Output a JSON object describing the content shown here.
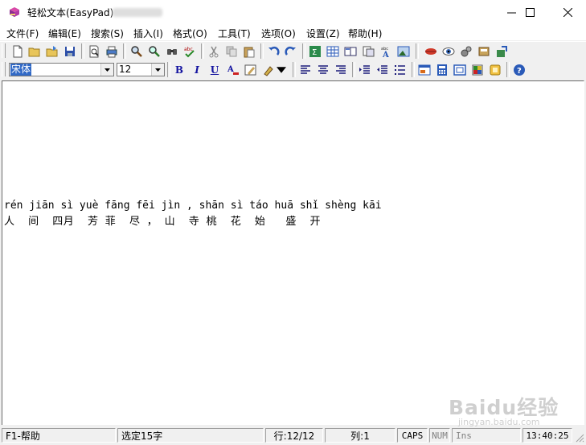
{
  "window": {
    "title": "轻松文本(EasyPad)"
  },
  "menu": [
    {
      "label": "文件(F)"
    },
    {
      "label": "编辑(E)"
    },
    {
      "label": "搜索(S)"
    },
    {
      "label": "插入(I)"
    },
    {
      "label": "格式(O)"
    },
    {
      "label": "工具(T)"
    },
    {
      "label": "选项(O)"
    },
    {
      "label": "设置(Z)"
    },
    {
      "label": "帮助(H)"
    }
  ],
  "toolbar2": {
    "font_name": "宋体",
    "font_size": "12",
    "bold_label": "B",
    "italic_label": "I",
    "underline_label": "U"
  },
  "editor": {
    "pinyin_line": "rén jiān sì yuè fāng fēi jìn , shān sì táo huā shǐ shèng kāi",
    "hanzi_line": "人  间  四月  芳 菲  尽 ， 山  寺 桃  花  始   盛  开"
  },
  "statusbar": {
    "help": "F1-帮助",
    "selection": "选定15字",
    "line": "行:12/12",
    "column": "列:1",
    "caps": "CAPS",
    "num": "NUM",
    "ins": "Ins",
    "time": "13:40:25"
  },
  "watermark": {
    "main": "Baidu经验",
    "sub": "jingyan.baidu.com"
  },
  "icons": [
    "new-file-icon",
    "open-folder-icon",
    "open-recent-icon",
    "save-icon",
    "print-preview-icon",
    "print-icon",
    "find-icon",
    "replace-icon",
    "find-next-icon",
    "spellcheck-icon",
    "cut-icon",
    "copy-icon",
    "paste-icon",
    "undo-icon",
    "redo-icon",
    "sum-icon",
    "table-icon",
    "book-icon",
    "doc-icon",
    "word-count-icon",
    "image-icon",
    "lips-icon",
    "eye-icon",
    "gear-icon",
    "scan-icon",
    "export-icon",
    "font-color-icon",
    "highlight-icon",
    "clear-format-icon",
    "align-left-icon",
    "align-center-icon",
    "align-right-icon",
    "indent-icon",
    "outdent-icon",
    "list-icon",
    "window-icon",
    "calc-icon",
    "frame-icon",
    "color-icon",
    "note-icon",
    "help-icon"
  ]
}
